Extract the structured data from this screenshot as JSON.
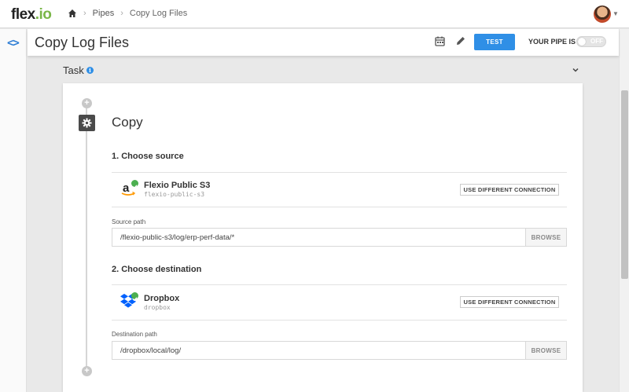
{
  "app": {
    "logo_text": "flex",
    "logo_dot": ".io"
  },
  "breadcrumb": {
    "items": [
      "Pipes",
      "Copy Log Files"
    ]
  },
  "header": {
    "title": "Copy Log Files",
    "test_label": "TEST",
    "pipe_is_label": "YOUR PIPE IS",
    "toggle_state": "OFF"
  },
  "task": {
    "label": "Task"
  },
  "step": {
    "title": "Copy",
    "source": {
      "heading": "1. Choose source",
      "connection_name": "Flexio Public S3",
      "connection_id": "flexio-public-s3",
      "connection_icon": "amazon-icon",
      "change_label": "USE DIFFERENT CONNECTION",
      "path_label": "Source path",
      "path_value": "/flexio-public-s3/log/erp-perf-data/*",
      "browse_label": "BROWSE"
    },
    "destination": {
      "heading": "2. Choose destination",
      "connection_name": "Dropbox",
      "connection_id": "dropbox",
      "connection_icon": "dropbox-icon",
      "change_label": "USE DIFFERENT CONNECTION",
      "path_label": "Destination path",
      "path_value": "/dropbox/local/log/",
      "browse_label": "BROWSE"
    }
  },
  "colors": {
    "accent": "#2f8fe6",
    "success": "#4caf50",
    "dropbox": "#0061fe",
    "amazon_orange": "#f90"
  }
}
